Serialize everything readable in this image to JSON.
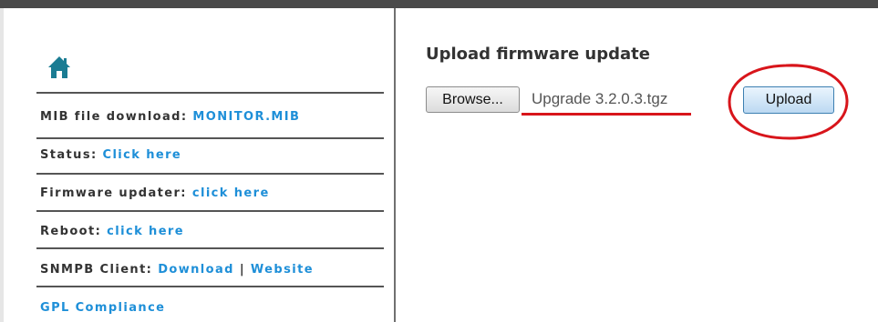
{
  "sidebar": {
    "home_icon": "home-icon",
    "items": [
      {
        "label": "MIB file download:",
        "link": "MONITOR.MIB"
      },
      {
        "label": "Status:",
        "link": "Click here"
      },
      {
        "label": "Firmware updater:",
        "link": "click here"
      },
      {
        "label": "Reboot:",
        "link": "click here"
      },
      {
        "label": "SNMPB Client:",
        "link": "Download",
        "separator": "|",
        "link2": "Website"
      },
      {
        "label": "",
        "link": "GPL Compliance"
      }
    ]
  },
  "main": {
    "title": "Upload firmware update",
    "browse_label": "Browse...",
    "file_name": "Upgrade 3.2.0.3.tgz",
    "upload_label": "Upload"
  },
  "colors": {
    "link": "#1e8fd8",
    "text": "#333333",
    "annotation_red": "#d8151b",
    "top_bar": "#4a4a4a"
  }
}
